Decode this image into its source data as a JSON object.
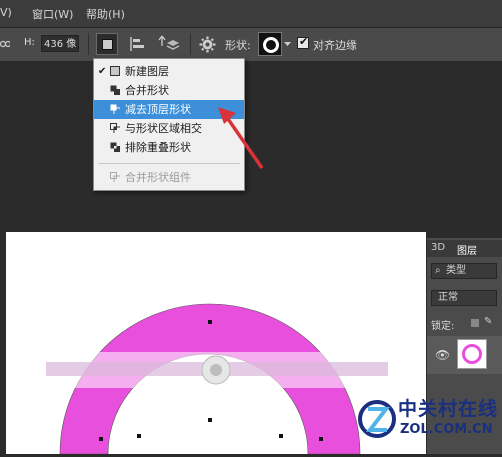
{
  "menubar": {
    "items": [
      "V)",
      "窗口(W)",
      "帮助(H)"
    ]
  },
  "options": {
    "h_label": "H:",
    "h_value": "436 像",
    "shape_label": "形状:",
    "align_label": "对齐边缘",
    "align_checked": true
  },
  "dropdown": {
    "items": [
      {
        "label": "新建图层",
        "checked": true,
        "state": "normal"
      },
      {
        "label": "合并形状",
        "checked": false,
        "state": "normal"
      },
      {
        "label": "减去顶层形状",
        "checked": false,
        "state": "selected"
      },
      {
        "label": "与形状区域相交",
        "checked": false,
        "state": "normal"
      },
      {
        "label": "排除重叠形状",
        "checked": false,
        "state": "normal"
      },
      {
        "label": "合并形状组件",
        "checked": false,
        "state": "disabled"
      }
    ]
  },
  "layers_panel": {
    "tabs": [
      "3D",
      "图层"
    ],
    "filter": "类型",
    "blend_mode": "正常",
    "lock_label": "锁定:"
  },
  "watermark": {
    "brand": "中关村在线",
    "url": "ZOL.COM.CN"
  },
  "colors": {
    "ring": "#e94fdd",
    "selection": "#3c8fd8",
    "arrow": "#d9333a"
  }
}
